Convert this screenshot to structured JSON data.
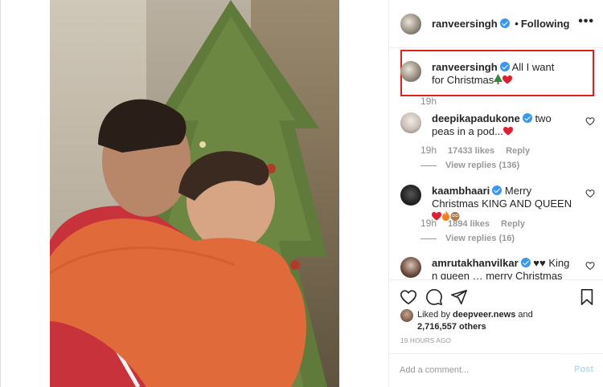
{
  "header": {
    "username": "ranveersingh",
    "separator": "•",
    "follow_status": "Following",
    "more_label": "•••"
  },
  "caption": {
    "username": "ranveersingh",
    "text": "All I want for Christmas",
    "time": "19h"
  },
  "comments": [
    {
      "username": "deepikapadukone",
      "text": "two peas in a pod...",
      "time": "19h",
      "likes": "17433 likes",
      "reply_label": "Reply",
      "view_replies": "View replies (136)"
    },
    {
      "username": "kaambhaari",
      "text": "Merry Christmas KING AND QUEEN",
      "time": "19h",
      "likes": "1894 likes",
      "reply_label": "Reply",
      "view_replies": "View replies (16)"
    },
    {
      "username": "amrutakhanvilkar",
      "text": "♥♥ King n queen … merry Christmas"
    }
  ],
  "likes": {
    "prefix": "Liked by",
    "user": "deepveer.news",
    "suffix": "and",
    "count": "2,716,557 others"
  },
  "timestamp": "19 HOURS AGO",
  "add_comment": {
    "placeholder": "Add a comment...",
    "post_label": "Post"
  },
  "colors": {
    "highlight_box": "#e0201b",
    "verified": "#3897f0",
    "post_disabled": "#b3dbff"
  },
  "icons": [
    "heart-icon",
    "comment-icon",
    "share-icon",
    "bookmark-icon",
    "verified-icon",
    "more-icon"
  ]
}
